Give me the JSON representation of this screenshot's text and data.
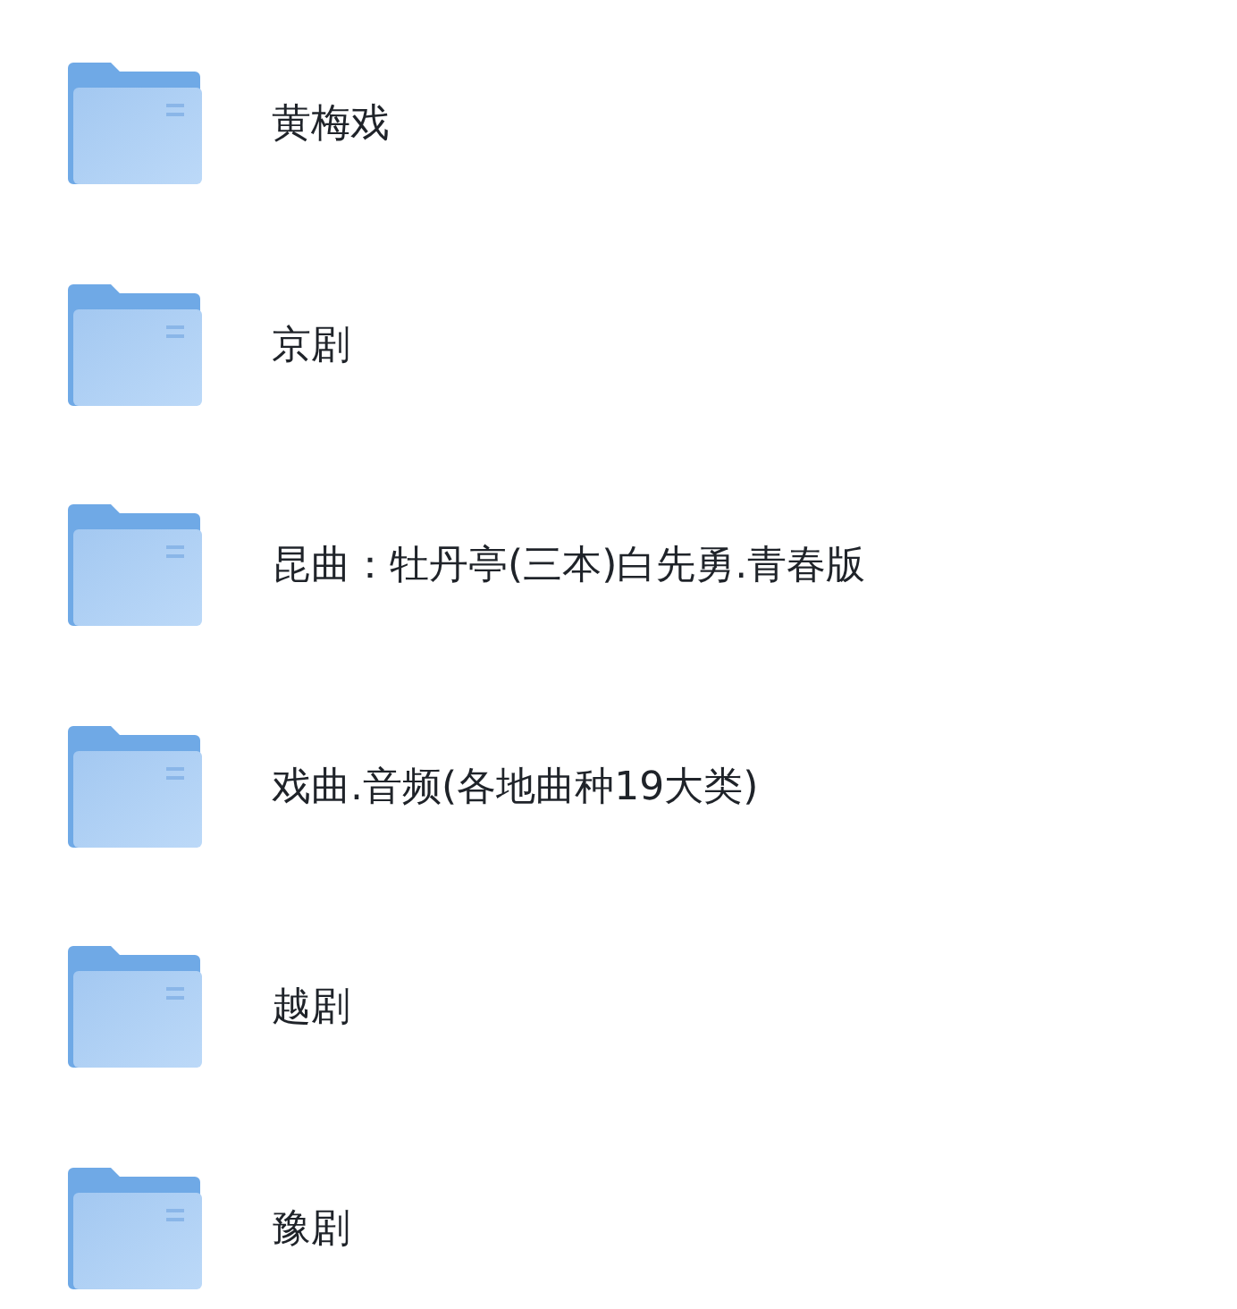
{
  "folders": [
    {
      "name": "黄梅戏"
    },
    {
      "name": "京剧"
    },
    {
      "name": "昆曲：牡丹亭(三本)白先勇.青春版"
    },
    {
      "name": "戏曲.音频(各地曲种19大类)"
    },
    {
      "name": "越剧"
    },
    {
      "name": "豫剧"
    }
  ]
}
